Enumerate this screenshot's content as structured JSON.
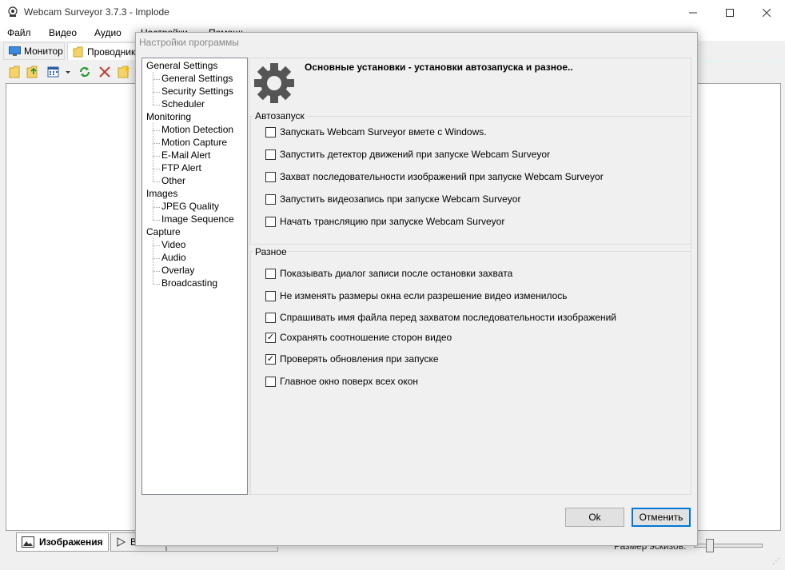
{
  "window": {
    "title": "Webcam Surveyor 3.7.3 - Implode"
  },
  "menu": [
    "Файл",
    "Видео",
    "Аудио",
    "Настройки",
    "Помощь"
  ],
  "main_tabs": [
    "Монитор",
    "Проводник"
  ],
  "bottom": {
    "tab_images": "Изображения",
    "tab2_fragment": "В",
    "size_label": "Размер эскизов:",
    "thumbnail_size_slider": 0.2
  },
  "dialog": {
    "title": "Настройки программы",
    "tree": [
      {
        "label": "General Settings",
        "level": 0
      },
      {
        "label": "General Settings",
        "level": 1
      },
      {
        "label": "Security Settings",
        "level": 1
      },
      {
        "label": "Scheduler",
        "level": 1
      },
      {
        "label": "Monitoring",
        "level": 0
      },
      {
        "label": "Motion Detection",
        "level": 1
      },
      {
        "label": "Motion Capture",
        "level": 1
      },
      {
        "label": "E-Mail Alert",
        "level": 1
      },
      {
        "label": "FTP Alert",
        "level": 1
      },
      {
        "label": "Other",
        "level": 1
      },
      {
        "label": "Images",
        "level": 0
      },
      {
        "label": "JPEG Quality",
        "level": 1
      },
      {
        "label": "Image Sequence",
        "level": 1
      },
      {
        "label": "Capture",
        "level": 0
      },
      {
        "label": "Video",
        "level": 1
      },
      {
        "label": "Audio",
        "level": 1
      },
      {
        "label": "Overlay",
        "level": 1
      },
      {
        "label": "Broadcasting",
        "level": 1
      }
    ],
    "heading": "Основные установки - установки автозапуска и разное..",
    "group_autostart": {
      "label": "Автозапуск",
      "options": [
        {
          "label": "Запускать Webcam Surveyor вмете с Windows.",
          "checked": false
        },
        {
          "label": "Запустить детектор движений при запуске Webcam Surveyor",
          "checked": false
        },
        {
          "label": "Захват последовательности изображений при запуске Webcam Surveyor",
          "checked": false
        },
        {
          "label": "Запустить видеозапись при запуске Webcam Surveyor",
          "checked": false
        },
        {
          "label": "Начать трансляцию при запуске Webcam Surveyor",
          "checked": false
        }
      ]
    },
    "group_misc": {
      "label": "Разное",
      "options": [
        {
          "label": "Показывать диалог записи после остановки захвата",
          "checked": false
        },
        {
          "label": "Не изменять размеры окна если разрешение видео изменилось",
          "checked": false
        },
        {
          "label": "Спрашивать имя файла перед захватом последовательности изображений",
          "checked": false
        },
        {
          "label": "Сохранять соотношение сторон видео",
          "checked": true
        },
        {
          "label": "Проверять обновления при запуске",
          "checked": true
        },
        {
          "label": "Главное окно поверх всех окон",
          "checked": false
        }
      ]
    },
    "ok_label": "Ok",
    "cancel_label": "Отменить"
  }
}
